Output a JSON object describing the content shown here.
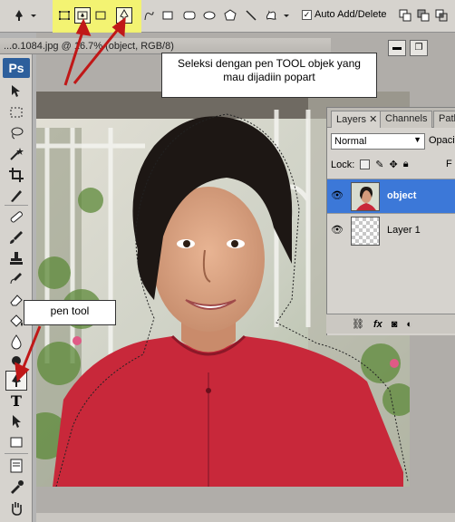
{
  "toolbar": {
    "auto_add_label": "Auto Add/Delete",
    "auto_add_checked": true,
    "checkmark": "✓"
  },
  "document": {
    "tab_title": "...o.1084.jpg @ 16.7% (object, RGB/8)"
  },
  "tools_panel": {
    "logo": "Ps",
    "type_tool": "T"
  },
  "callouts": {
    "main": "Seleksi dengan pen TOOL objek yang mau dijadiin popart",
    "pen": "pen tool"
  },
  "layers_panel": {
    "tabs": [
      "Layers",
      "Channels",
      "Path"
    ],
    "blend_mode": "Normal",
    "opacity_label": "Opacit",
    "lock_label": "Lock:",
    "fill_label": "F",
    "layers": [
      {
        "name": "object",
        "selected": true
      },
      {
        "name": "Layer 1",
        "selected": false
      }
    ],
    "footer_fx": "fx"
  },
  "colors": {
    "highlight": "#f5f56a",
    "selected_layer": "#3c78d8",
    "shirt": "#c8283a",
    "arrow": "#c01818",
    "panel": "#d6d3ce"
  },
  "icons": {
    "optbar": [
      "pen-tool-icon",
      "shape-layers-icon",
      "paths-icon",
      "fill-pixels-icon",
      "pen-icon",
      "freeform-pen-icon",
      "rectangle-icon",
      "rounded-rectangle-icon",
      "ellipse-icon",
      "polygon-icon",
      "line-icon",
      "custom-shape-icon"
    ],
    "tools": [
      "move-tool-icon",
      "marquee-tool-icon",
      "lasso-tool-icon",
      "magic-wand-icon",
      "crop-tool-icon",
      "slice-tool-icon",
      "healing-brush-icon",
      "brush-tool-icon",
      "clone-stamp-icon",
      "history-brush-icon",
      "eraser-icon",
      "paint-bucket-icon",
      "blur-tool-icon",
      "dodge-tool-icon",
      "pen-tool-icon",
      "type-tool-icon",
      "path-selection-icon",
      "rectangle-tool-icon",
      "notes-tool-icon",
      "eyedropper-icon",
      "hand-tool-icon"
    ]
  }
}
